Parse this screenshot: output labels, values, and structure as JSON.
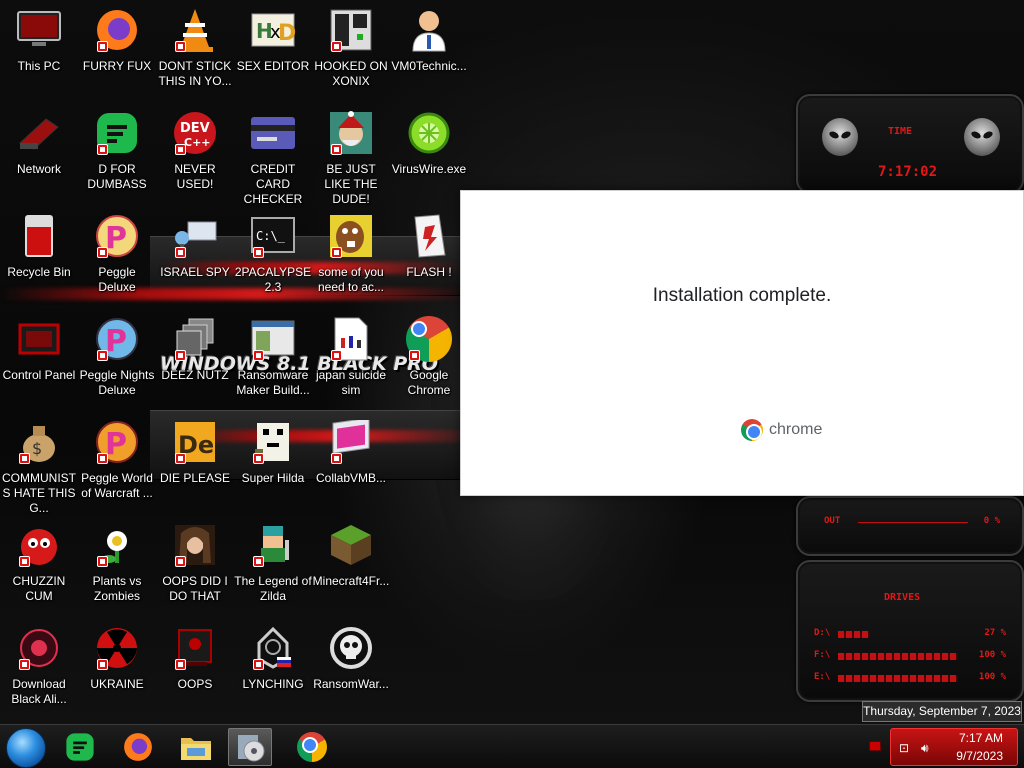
{
  "desktop": {
    "wallpaper_text": "WINDOWS 8.1 BLACK PRO",
    "icons": [
      {
        "label": "This PC"
      },
      {
        "label": "FURRY FUX"
      },
      {
        "label": "DONT STICK THIS IN YO..."
      },
      {
        "label": "SEX EDITOR"
      },
      {
        "label": "HOOKED ON XONIX"
      },
      {
        "label": "VM0Technic..."
      },
      {
        "label": "Network"
      },
      {
        "label": "D FOR DUMBASS"
      },
      {
        "label": "NEVER USED!"
      },
      {
        "label": "CREDIT CARD CHECKER"
      },
      {
        "label": "BE JUST LIKE THE DUDE!"
      },
      {
        "label": "VirusWire.exe"
      },
      {
        "label": "Recycle Bin"
      },
      {
        "label": "Peggle Deluxe"
      },
      {
        "label": "ISRAEL SPY"
      },
      {
        "label": "2PACALYPSE 2.3"
      },
      {
        "label": "some of you need to ac..."
      },
      {
        "label": "FLASH !"
      },
      {
        "label": "Control Panel"
      },
      {
        "label": "Peggle Nights Deluxe"
      },
      {
        "label": "DEEZ NUTZ"
      },
      {
        "label": "Ransomware Maker Build..."
      },
      {
        "label": "japan suicide sim"
      },
      {
        "label": "Google Chrome"
      },
      {
        "label": "COMMUNISTS HATE THIS G..."
      },
      {
        "label": "Peggle World of Warcraft ..."
      },
      {
        "label": "DIE PLEASE"
      },
      {
        "label": "Super Hilda"
      },
      {
        "label": "CollabVMB..."
      },
      {
        "label": "CHUZZIN CUM"
      },
      {
        "label": "Plants vs Zombies"
      },
      {
        "label": "OOPS DID I DO THAT"
      },
      {
        "label": "The Legend of Zilda"
      },
      {
        "label": "Minecraft4Fr..."
      },
      {
        "label": "Download Black Ali..."
      },
      {
        "label": "UKRAINE"
      },
      {
        "label": "OOPS"
      },
      {
        "label": "LYNCHING"
      },
      {
        "label": "RansomWar..."
      }
    ]
  },
  "gadget": {
    "time_title": "TIME",
    "time_value": "7:17:02",
    "out_label": "OUT",
    "out_value": "0 %",
    "drives_title": "DRIVES",
    "drives": [
      {
        "letter": "D:\\",
        "pct": "27 %",
        "fill": 0.27
      },
      {
        "letter": "F:\\",
        "pct": "100 %",
        "fill": 1.0
      },
      {
        "letter": "E:\\",
        "pct": "100 %",
        "fill": 1.0
      }
    ]
  },
  "installer": {
    "message": "Installation complete.",
    "brand": "chrome"
  },
  "taskbar": {
    "pinned": [
      "feedly-icon",
      "firefox-icon",
      "file-explorer-icon",
      "media-installer-icon",
      "chrome-icon"
    ],
    "clock_time": "7:17 AM",
    "clock_date": "9/7/2023",
    "tooltip": "Thursday, September 7, 2023"
  }
}
